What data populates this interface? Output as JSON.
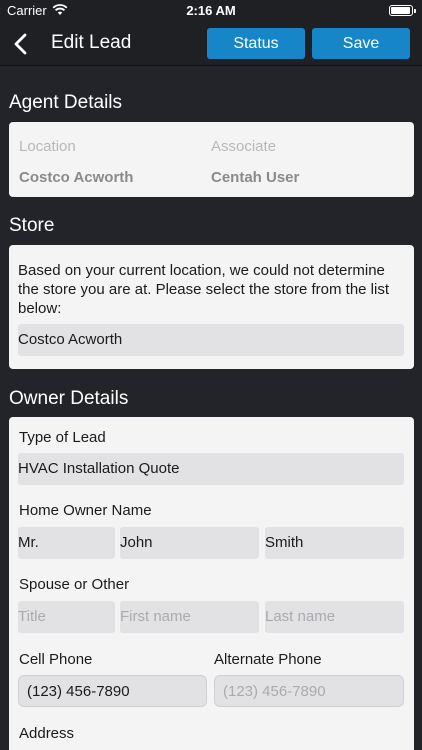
{
  "status_bar": {
    "carrier": "Carrier",
    "time": "2:16 AM"
  },
  "nav": {
    "title": "Edit Lead",
    "status_label": "Status",
    "save_label": "Save"
  },
  "agent_details": {
    "title": "Agent Details",
    "location_label": "Location",
    "location_value": "Costco Acworth",
    "associate_label": "Associate",
    "associate_value": "Centah User"
  },
  "store": {
    "title": "Store",
    "message": "Based on your current location, we could not determine the store you are at. Please select the store from the list below:",
    "selected": "Costco Acworth"
  },
  "owner_details": {
    "title": "Owner Details",
    "type_label": "Type of Lead",
    "type_value": "HVAC Installation Quote",
    "home_owner_label": "Home Owner Name",
    "home_owner": {
      "title": "Mr.",
      "first": "John",
      "last": "Smith"
    },
    "spouse_label": "Spouse or Other",
    "spouse_placeholders": {
      "title": "Title",
      "first": "First name",
      "last": "Last name"
    },
    "cell_label": "Cell Phone",
    "cell_value": "(123) 456-7890",
    "alt_label": "Alternate Phone",
    "alt_placeholder": "(123) 456-7890",
    "address_label": "Address"
  },
  "colors": {
    "accent": "#1786c8",
    "background": "#222429",
    "card": "#f4f4f5",
    "field": "#e2e2e4"
  }
}
